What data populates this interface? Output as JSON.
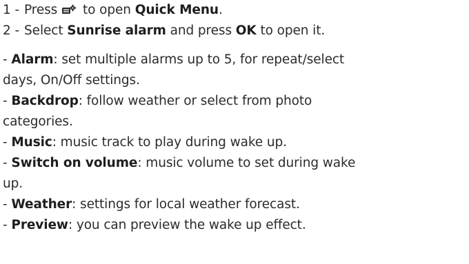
{
  "steps": [
    {
      "number": "1 -",
      "before": "Press",
      "icon": "quick-menu-icon",
      "middle": " to open ",
      "highlight": "Quick Menu",
      "after": "."
    },
    {
      "number": "2 -",
      "before": "Select ",
      "highlight": "Sunrise alarm",
      "middle": " and press ",
      "highlight2": "OK",
      "after": " to open it."
    }
  ],
  "settings": [
    {
      "prefix": "- ",
      "term": "Alarm",
      "description": ": set multiple alarms up to 5, for repeat/select",
      "continuation": "days, On/Off settings."
    },
    {
      "prefix": "- ",
      "term": "Backdrop",
      "description": ": follow weather or select from photo",
      "continuation": "categories."
    },
    {
      "prefix": "- ",
      "term": "Music",
      "description": ": music track to play during wake up."
    },
    {
      "prefix": "- ",
      "term": "Switch on volume",
      "description": ": music volume to set during wake",
      "continuation": "up."
    },
    {
      "prefix": "- ",
      "term": "Weather",
      "description": ": settings for local weather forecast."
    },
    {
      "prefix": "- ",
      "term": "Preview",
      "description": ": you can preview the wake up effect."
    }
  ]
}
